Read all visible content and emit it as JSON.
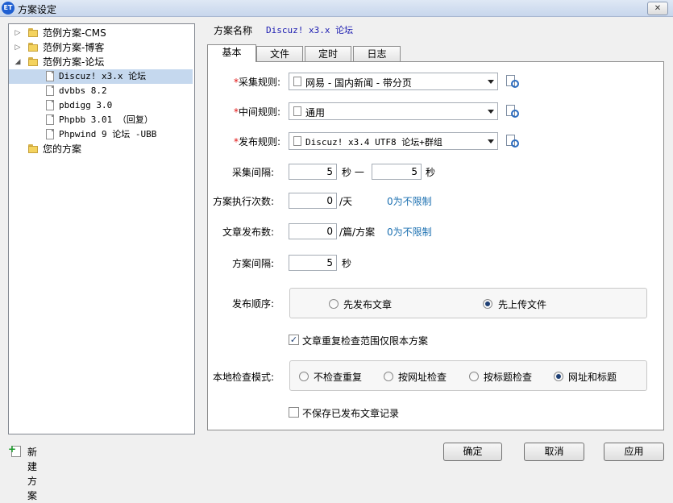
{
  "window": {
    "title": "方案设定",
    "app_icon": "ET",
    "close_symbol": "✕"
  },
  "tree": {
    "items": [
      {
        "label": "范例方案-CMS",
        "kind": "folder",
        "expander": "▷"
      },
      {
        "label": "范例方案-博客",
        "kind": "folder",
        "expander": "▷"
      },
      {
        "label": "范例方案-论坛",
        "kind": "folder",
        "expander": "◢"
      },
      {
        "label": "Discuz! x3.x 论坛",
        "kind": "doc",
        "selected": true
      },
      {
        "label": "dvbbs 8.2",
        "kind": "doc"
      },
      {
        "label": "pbdigg 3.0",
        "kind": "doc"
      },
      {
        "label": "Phpbb 3.01 （回复）",
        "kind": "doc"
      },
      {
        "label": "Phpwind 9 论坛 -UBB",
        "kind": "doc"
      },
      {
        "label": "您的方案",
        "kind": "folder"
      }
    ],
    "new_plan": "新建方案"
  },
  "plan": {
    "name_label": "方案名称",
    "name_value": "Discuz! x3.x 论坛"
  },
  "tabs": [
    {
      "label": "基本",
      "active": true
    },
    {
      "label": "文件"
    },
    {
      "label": "定时"
    },
    {
      "label": "日志"
    }
  ],
  "form": {
    "required_mark": "*",
    "collect_rule": {
      "label": "采集规则:",
      "value": "网易 - 国内新闻 - 带分页"
    },
    "middle_rule": {
      "label": "中间规则:",
      "value": "通用"
    },
    "publish_rule": {
      "label": "发布规则:",
      "value": "Discuz! x3.4 UTF8 论坛+群组"
    },
    "interval": {
      "label": "采集间隔:",
      "from": "5",
      "sep": "秒 一",
      "to": "5",
      "unit": "秒"
    },
    "exec_count": {
      "label": "方案执行次数:",
      "value": "0",
      "unit": "/天",
      "hint": "0为不限制"
    },
    "publish_count": {
      "label": "文章发布数:",
      "value": "0",
      "unit": "/篇/方案",
      "hint": "0为不限制"
    },
    "plan_interval": {
      "label": "方案间隔:",
      "value": "5",
      "unit": "秒"
    },
    "publish_order": {
      "label": "发布顺序:",
      "options": [
        "先发布文章",
        "先上传文件"
      ],
      "selected": 1
    },
    "dup_check": {
      "label": "文章重复检查范围仅限本方案",
      "checked": true,
      "check_mark": "✓"
    },
    "local_check": {
      "label": "本地检查模式:",
      "options": [
        "不检查重复",
        "按网址检查",
        "按标题检查",
        "网址和标题"
      ],
      "selected": 3
    },
    "no_save": {
      "label": "不保存已发布文章记录",
      "checked": false
    }
  },
  "buttons": {
    "ok": "确定",
    "cancel": "取消",
    "apply": "应用"
  }
}
